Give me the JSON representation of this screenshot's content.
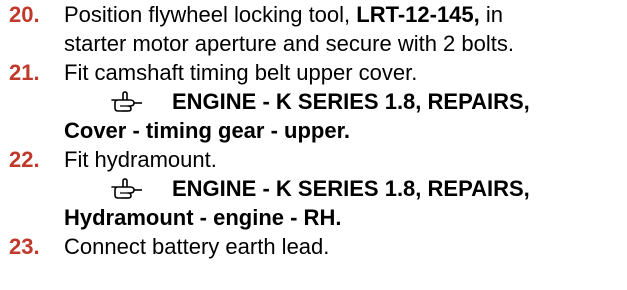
{
  "steps": [
    {
      "number": "20.",
      "line1_pre": "Position flywheel locking tool, ",
      "line1_bold": "LRT-12-145,",
      "line1_post": " in",
      "line2": "starter motor aperture and secure with 2 bolts."
    },
    {
      "number": "21.",
      "text": "Fit camshaft timing belt upper cover.",
      "ref_icon": "pointing-hand-icon",
      "ref_line1": "ENGINE - K SERIES 1.8, REPAIRS,",
      "ref_line2": "Cover - timing gear - upper."
    },
    {
      "number": "22.",
      "text": "Fit hydramount.",
      "ref_icon": "pointing-hand-icon",
      "ref_line1": "ENGINE - K SERIES 1.8, REPAIRS,",
      "ref_line2": "Hydramount - engine - RH."
    },
    {
      "number": "23.",
      "text": "Connect battery earth lead."
    }
  ],
  "colors": {
    "number": "#c0392b",
    "text": "#000000"
  }
}
